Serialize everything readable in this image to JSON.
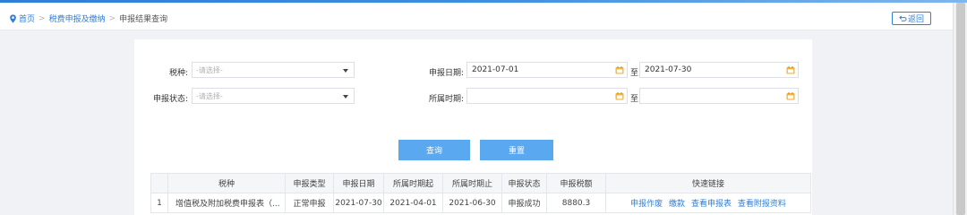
{
  "breadcrumb": {
    "home": "首页",
    "level1": "税费申报及缴纳",
    "current": "申报结果查询",
    "separator": ">"
  },
  "back_button": "返回",
  "form": {
    "tax_type_label": "税种:",
    "tax_type_placeholder": "-请选择-",
    "status_label": "申报状态:",
    "status_placeholder": "-请选择-",
    "date_label": "申报日期:",
    "date_from": "2021-07-01",
    "date_to": "2021-07-30",
    "period_label": "所属时期:",
    "period_from": "",
    "period_to": "",
    "to_label": "至"
  },
  "buttons": {
    "query": "查询",
    "reset": "重置"
  },
  "table": {
    "headers": [
      "",
      "税种",
      "申报类型",
      "申报日期",
      "所属时期起",
      "所属时期止",
      "申报状态",
      "申报税额",
      "快速链接"
    ],
    "rows": [
      {
        "index": "1",
        "tax_type": "增值税及附加税费申报表（...",
        "declare_type": "正常申报",
        "declare_date": "2021-07-30",
        "period_start": "2021-04-01",
        "period_end": "2021-06-30",
        "status": "申报成功",
        "amount": "8880.3",
        "links": [
          "申报作废",
          "缴款",
          "查看申报表",
          "查看附报资料"
        ]
      }
    ]
  },
  "colors": {
    "accent": "#2f7fd8",
    "button": "#5aa9f0",
    "calendar_icon": "#f3b23a"
  }
}
